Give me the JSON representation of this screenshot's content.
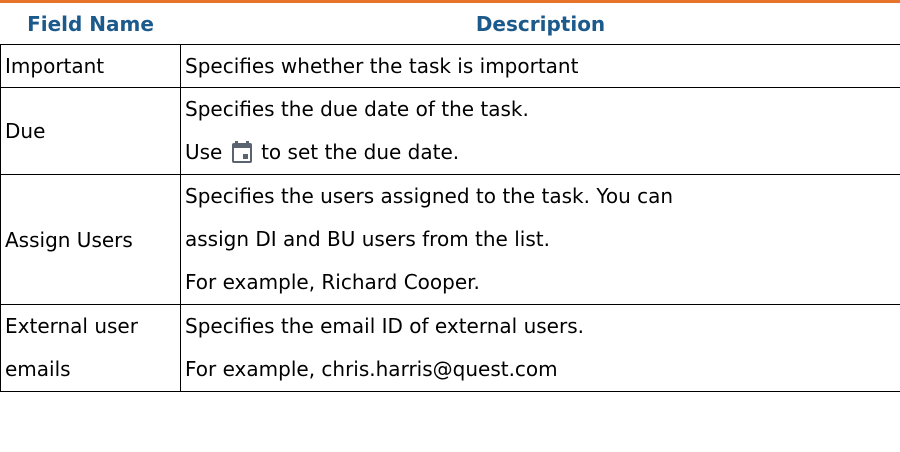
{
  "header": {
    "field_name": "Field Name",
    "description": "Description"
  },
  "rows": [
    {
      "field": "Important",
      "desc": [
        "Specifies whether the task is important"
      ]
    },
    {
      "field": "Due",
      "desc": [
        "Specifies the due date of the task."
      ],
      "use_prefix": "Use",
      "use_suffix": "to set the due date.",
      "icon": "calendar-icon"
    },
    {
      "field": "Assign Users",
      "desc": [
        "Specifies the users assigned to the task. You can",
        "assign DI and BU users from the list.",
        "For example, Richard Cooper."
      ]
    },
    {
      "field_lines": [
        "External user",
        "emails"
      ],
      "desc": [
        "Specifies the email ID of external users.",
        "For example, chris.harris@quest.com"
      ]
    }
  ],
  "colors": {
    "header_text": "#1c5a8c",
    "top_rule": "#e8742c"
  }
}
